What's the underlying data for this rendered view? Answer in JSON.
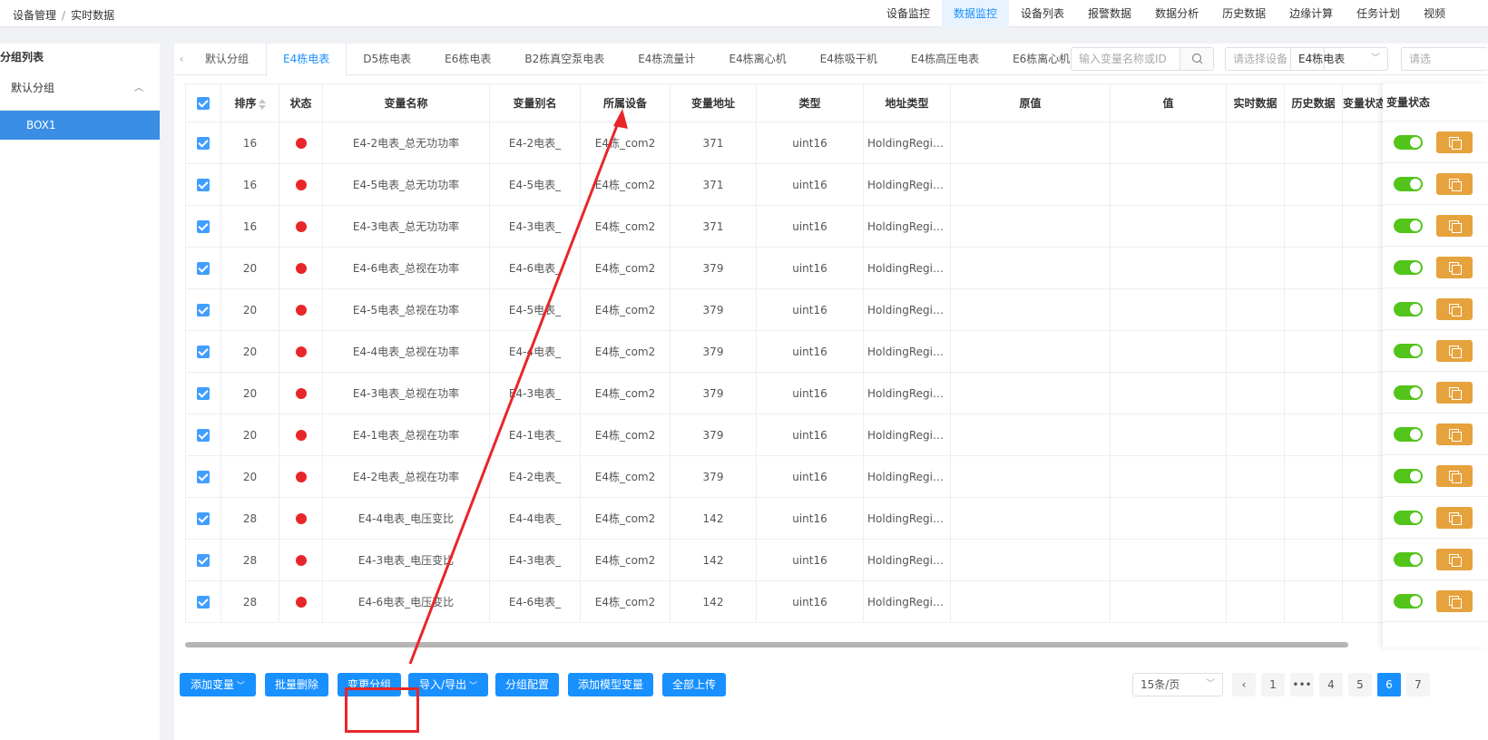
{
  "breadcrumb": {
    "root": "设备管理",
    "separator": "/",
    "current": "实时数据"
  },
  "nav_tabs": [
    "设备监控",
    "数据监控",
    "设备列表",
    "报警数据",
    "数据分析",
    "历史数据",
    "边缘计算",
    "任务计划",
    "视频"
  ],
  "sidebar": {
    "title": "分组列表",
    "group_label": "默认分组",
    "box_label": "BOX1"
  },
  "tabs": [
    "默认分组",
    "E4栋电表",
    "D5栋电表",
    "E6栋电表",
    "B2栋真空泵电表",
    "E4栋流量计",
    "E4栋离心机",
    "E4栋吸干机",
    "E4栋高压电表",
    "E6栋离心机"
  ],
  "toolbar": {
    "search_placeholder": "输入变量名称或ID",
    "device_placeholder": "请选择设备",
    "group_select": "E4栋电表",
    "extra_select": "请选"
  },
  "table": {
    "headers": [
      "排序",
      "状态",
      "变量名称",
      "变量别名",
      "所属设备",
      "变量地址",
      "类型",
      "地址类型",
      "原值",
      "值",
      "实时数据",
      "历史数据",
      "变量状态"
    ],
    "rows": [
      {
        "sort": "16",
        "name": "E4-2电表_总无功功率",
        "alias": "E4-2电表_",
        "device": "E4栋_com2",
        "addr": "371",
        "type": "uint16",
        "addr_type": "HoldingRegist..."
      },
      {
        "sort": "16",
        "name": "E4-5电表_总无功功率",
        "alias": "E4-5电表_",
        "device": "E4栋_com2",
        "addr": "371",
        "type": "uint16",
        "addr_type": "HoldingRegist..."
      },
      {
        "sort": "16",
        "name": "E4-3电表_总无功功率",
        "alias": "E4-3电表_",
        "device": "E4栋_com2",
        "addr": "371",
        "type": "uint16",
        "addr_type": "HoldingRegist..."
      },
      {
        "sort": "20",
        "name": "E4-6电表_总视在功率",
        "alias": "E4-6电表_",
        "device": "E4栋_com2",
        "addr": "379",
        "type": "uint16",
        "addr_type": "HoldingRegist..."
      },
      {
        "sort": "20",
        "name": "E4-5电表_总视在功率",
        "alias": "E4-5电表_",
        "device": "E4栋_com2",
        "addr": "379",
        "type": "uint16",
        "addr_type": "HoldingRegist..."
      },
      {
        "sort": "20",
        "name": "E4-4电表_总视在功率",
        "alias": "E4-4电表_",
        "device": "E4栋_com2",
        "addr": "379",
        "type": "uint16",
        "addr_type": "HoldingRegist..."
      },
      {
        "sort": "20",
        "name": "E4-3电表_总视在功率",
        "alias": "E4-3电表_",
        "device": "E4栋_com2",
        "addr": "379",
        "type": "uint16",
        "addr_type": "HoldingRegist..."
      },
      {
        "sort": "20",
        "name": "E4-1电表_总视在功率",
        "alias": "E4-1电表_",
        "device": "E4栋_com2",
        "addr": "379",
        "type": "uint16",
        "addr_type": "HoldingRegist..."
      },
      {
        "sort": "20",
        "name": "E4-2电表_总视在功率",
        "alias": "E4-2电表_",
        "device": "E4栋_com2",
        "addr": "379",
        "type": "uint16",
        "addr_type": "HoldingRegist..."
      },
      {
        "sort": "28",
        "name": "E4-4电表_电压变比",
        "alias": "E4-4电表_",
        "device": "E4栋_com2",
        "addr": "142",
        "type": "uint16",
        "addr_type": "HoldingRegist..."
      },
      {
        "sort": "28",
        "name": "E4-3电表_电压变比",
        "alias": "E4-3电表_",
        "device": "E4栋_com2",
        "addr": "142",
        "type": "uint16",
        "addr_type": "HoldingRegist..."
      },
      {
        "sort": "28",
        "name": "E4-6电表_电压变比",
        "alias": "E4-6电表_",
        "device": "E4栋_com2",
        "addr": "142",
        "type": "uint16",
        "addr_type": "HoldingRegist..."
      }
    ]
  },
  "footer": {
    "buttons": [
      "添加变量",
      "批量删除",
      "变更分组",
      "导入/导出",
      "分组配置",
      "添加模型变量",
      "全部上传"
    ],
    "page_size": "15条/页",
    "pages": [
      "1",
      "•••",
      "4",
      "5",
      "6",
      "7"
    ],
    "active_page": "6"
  },
  "colors": {
    "primary": "#1890ff",
    "status_dot": "#e8262a",
    "toggle_on": "#52c41a",
    "copy_button": "#e6a23c",
    "annotation": "#e8262a"
  }
}
